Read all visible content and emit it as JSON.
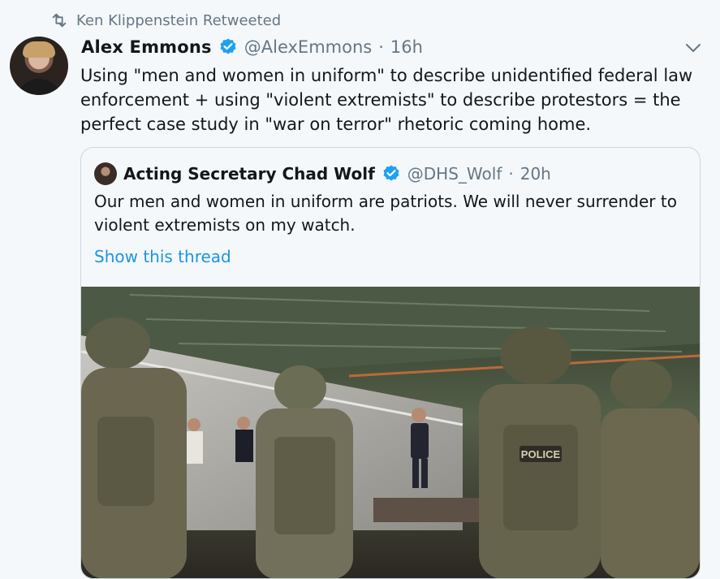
{
  "retweet": {
    "label": "Ken Klippenstein Retweeted"
  },
  "tweet": {
    "author": "Alex Emmons",
    "handle": "@AlexEmmons",
    "separator": "·",
    "time": "16h",
    "text": "Using \"men and women in uniform\" to describe unidentified federal law\nenforcement + using \"violent extremists\" to describe protestors = the\nperfect case study in \"war on terror\" rhetoric coming home."
  },
  "quote": {
    "author": "Acting Secretary Chad Wolf",
    "handle": "@DHS_Wolf",
    "separator": "·",
    "time": "20h",
    "text": "Our men and women in uniform are patriots. We will never surrender to violent extremists on my watch.",
    "show_thread": "Show this thread",
    "image_caption_text": "POLICE"
  },
  "colors": {
    "accent": "#1b95e0",
    "verified": "#1da1f2",
    "secondary_text": "#657786",
    "background": "#f5f8fa"
  },
  "icons": {
    "retweet": "retweet-icon",
    "verified": "verified-icon",
    "menu": "chevron-down-icon"
  }
}
